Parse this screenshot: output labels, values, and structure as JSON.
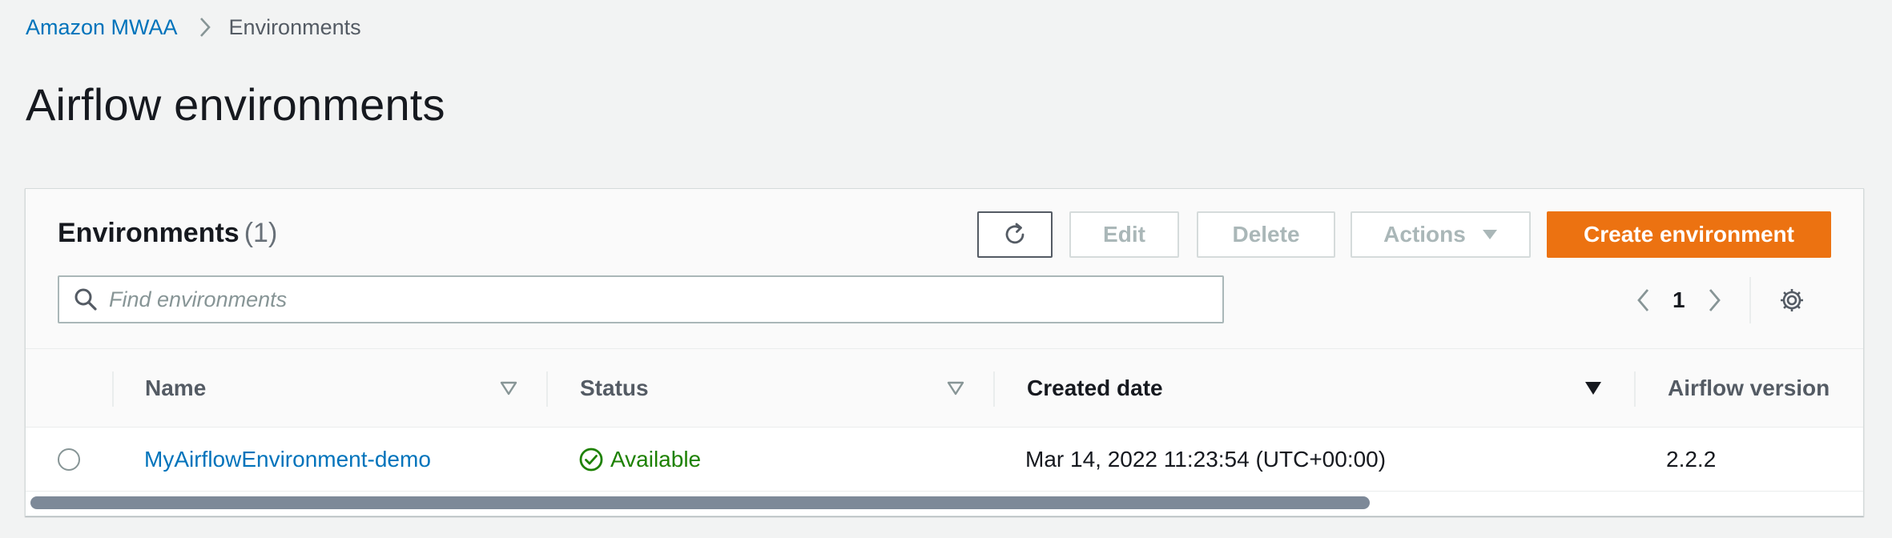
{
  "breadcrumb": {
    "root": "Amazon MWAA",
    "current": "Environments"
  },
  "page": {
    "title": "Airflow environments"
  },
  "panel": {
    "title": "Environments",
    "count": "(1)"
  },
  "toolbar": {
    "refresh_icon": "refresh-icon",
    "edit_label": "Edit",
    "delete_label": "Delete",
    "actions_label": "Actions",
    "create_label": "Create environment"
  },
  "search": {
    "placeholder": "Find environments",
    "value": ""
  },
  "pagination": {
    "current_page": "1"
  },
  "table": {
    "columns": [
      "Name",
      "Status",
      "Created date",
      "Airflow version"
    ],
    "sorted_column": "Created date",
    "rows": [
      {
        "selected": false,
        "name": "MyAirflowEnvironment-demo",
        "status": "Available",
        "created": "Mar 14, 2022 11:23:54 (UTC+00:00)",
        "airflow_version": "2.2.2"
      }
    ]
  },
  "colors": {
    "link": "#0073bb",
    "primary_button": "#ec7211",
    "status_available": "#1d8102",
    "background": "#f2f3f3"
  }
}
